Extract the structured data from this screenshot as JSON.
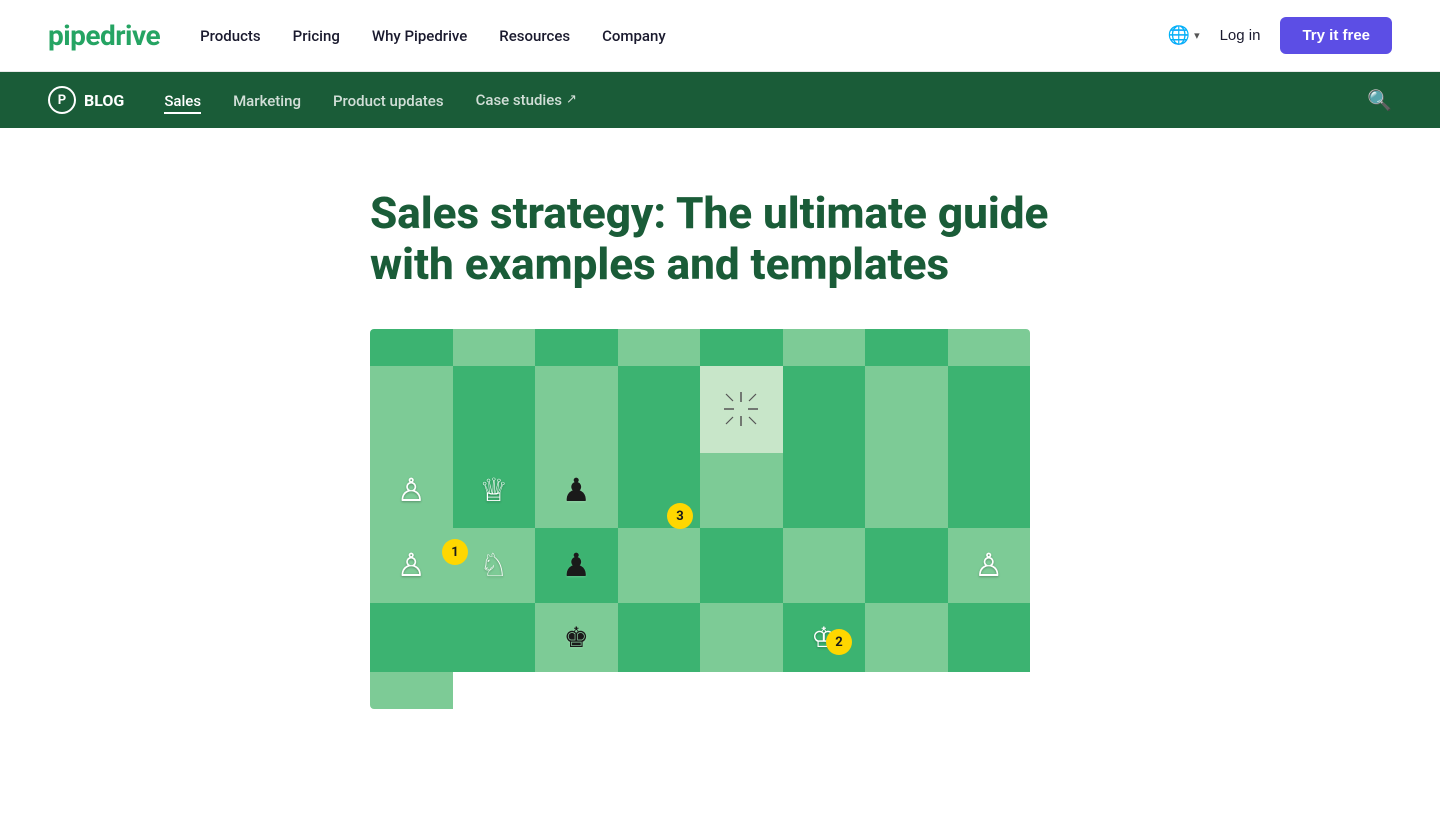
{
  "brand": {
    "logo": "pipedrive",
    "colors": {
      "primary_green": "#25a463",
      "dark_green": "#1a5c38",
      "purple": "#5c4ee5"
    }
  },
  "top_nav": {
    "links": [
      {
        "id": "products",
        "label": "Products"
      },
      {
        "id": "pricing",
        "label": "Pricing"
      },
      {
        "id": "why-pipedrive",
        "label": "Why Pipedrive"
      },
      {
        "id": "resources",
        "label": "Resources"
      },
      {
        "id": "company",
        "label": "Company"
      }
    ],
    "login_label": "Log in",
    "try_label": "Try it free"
  },
  "blog_nav": {
    "logo_letter": "P",
    "blog_label": "BLOG",
    "links": [
      {
        "id": "sales",
        "label": "Sales",
        "active": true
      },
      {
        "id": "marketing",
        "label": "Marketing",
        "active": false
      },
      {
        "id": "product-updates",
        "label": "Product updates",
        "active": false
      },
      {
        "id": "case-studies",
        "label": "Case studies",
        "active": false,
        "external": true
      }
    ]
  },
  "article": {
    "title": "Sales strategy: The ultimate guide with examples and templates"
  },
  "chess": {
    "badge1": "1",
    "badge2": "2",
    "badge3": "3"
  }
}
